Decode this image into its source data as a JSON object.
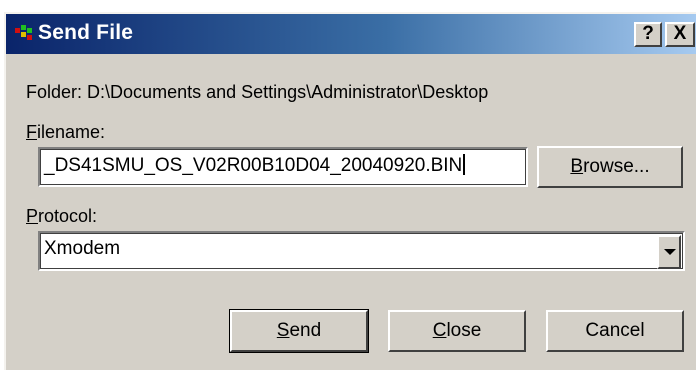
{
  "dialog": {
    "title": "Send File",
    "help_label": "?",
    "close_label": "X",
    "folder_prefix": "Folder:",
    "folder_path": "D:\\Documents and Settings\\Administrator\\Desktop",
    "filename_label_key": "F",
    "filename_label_rest": "ilename:",
    "filename_value": "_DS41SMU_OS_V02R00B10D04_20040920.BIN",
    "browse_key": "B",
    "browse_rest": "rowse...",
    "protocol_label_key": "P",
    "protocol_label_rest": "rotocol:",
    "protocol_value": "Xmodem",
    "send_key": "S",
    "send_rest": "end",
    "close_key": "C",
    "close_rest": "lose",
    "cancel_label": "Cancel"
  },
  "colors": {
    "titlebar_start": "#0a246a",
    "titlebar_end": "#a6caf0",
    "face": "#d4d0c8"
  },
  "icons": {
    "app": "send-file-app-icon",
    "dropdown": "chevron-down-icon"
  }
}
